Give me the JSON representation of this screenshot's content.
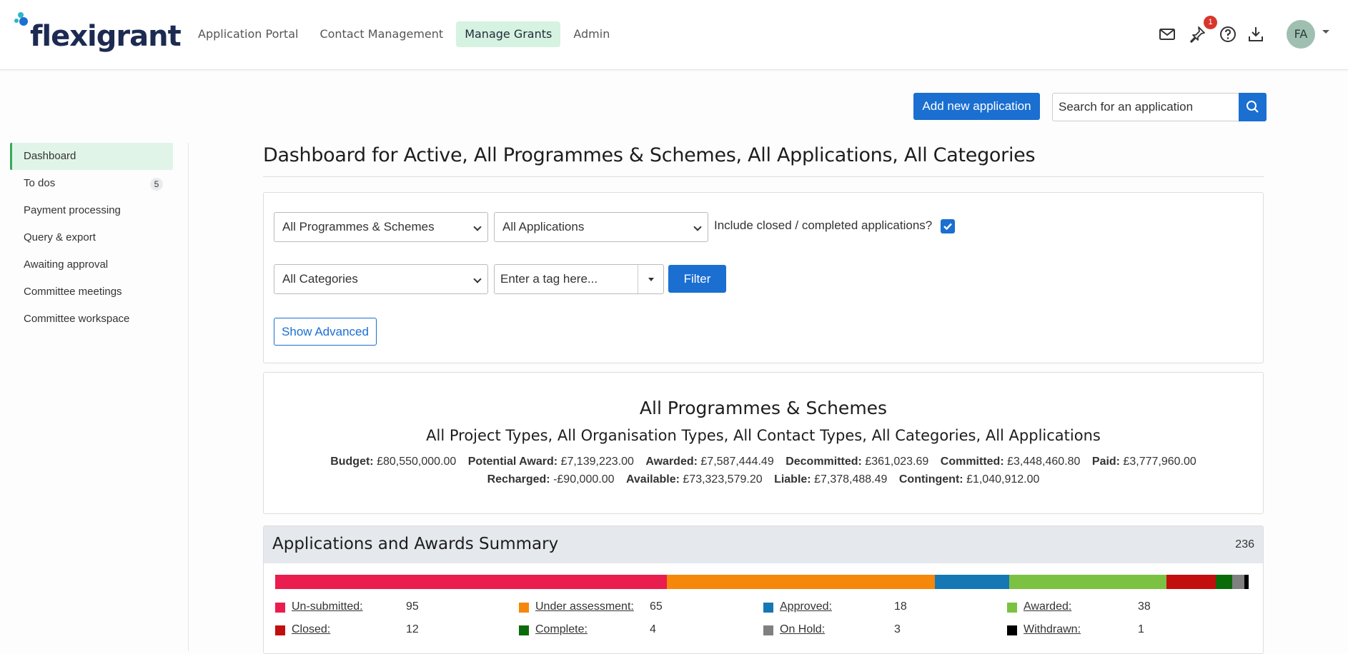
{
  "brand": {
    "logo_text": "flexigrant"
  },
  "nav": [
    {
      "label": "Application Portal"
    },
    {
      "label": "Contact Management"
    },
    {
      "label": "Manage Grants",
      "active": true
    },
    {
      "label": "Admin"
    }
  ],
  "header": {
    "icons": [
      "mail-icon",
      "pin-icon",
      "help-icon",
      "download-icon"
    ],
    "notification_count": "1",
    "avatar_initials": "FA"
  },
  "actions": {
    "add_label": "Add new application",
    "search_placeholder": "Search for an application"
  },
  "sidebar": {
    "items": [
      {
        "label": "Dashboard",
        "active": true
      },
      {
        "label": "To dos",
        "count": "5"
      },
      {
        "label": "Payment processing"
      },
      {
        "label": "Query & export"
      },
      {
        "label": "Awaiting approval"
      },
      {
        "label": "Committee meetings"
      },
      {
        "label": "Committee workspace"
      }
    ]
  },
  "page": {
    "title": "Dashboard for Active, All Programmes & Schemes, All Applications, All Categories"
  },
  "filters": {
    "programme": "All Programmes & Schemes",
    "applications": "All Applications",
    "include_label": "Include closed / completed applications?",
    "include_checked": true,
    "category": "All Categories",
    "tag_placeholder": "Enter a tag here...",
    "filter_label": "Filter",
    "advanced_label": "Show Advanced"
  },
  "summary": {
    "heading": "All Programmes & Schemes",
    "subheading": "All Project Types, All Organisation Types, All Contact Types, All Categories, All Applications",
    "row1": [
      {
        "label": "Budget:",
        "value": "£80,550,000.00"
      },
      {
        "label": "Potential Award:",
        "value": "£7,139,223.00"
      },
      {
        "label": "Awarded:",
        "value": "£7,587,444.49"
      },
      {
        "label": "Decommitted:",
        "value": "£361,023.69"
      },
      {
        "label": "Committed:",
        "value": "£3,448,460.80"
      },
      {
        "label": "Paid:",
        "value": "£3,777,960.00"
      }
    ],
    "row2": [
      {
        "label": "Recharged:",
        "value": "-£90,000.00"
      },
      {
        "label": "Available:",
        "value": "£73,323,579.20"
      },
      {
        "label": "Liable:",
        "value": "£7,378,488.49"
      },
      {
        "label": "Contingent:",
        "value": "£1,040,912.00"
      }
    ]
  },
  "apps_summary": {
    "title": "Applications and Awards Summary",
    "total": "236",
    "statuses": [
      {
        "label": "Un-submitted:",
        "value": 95,
        "color": "#e91e4e"
      },
      {
        "label": "Under assessment:",
        "value": 65,
        "color": "#f5870a"
      },
      {
        "label": "Approved:",
        "value": 18,
        "color": "#1578b5"
      },
      {
        "label": "Awarded:",
        "value": 38,
        "color": "#7cc242"
      },
      {
        "label": "Closed:",
        "value": 12,
        "color": "#c30e0e"
      },
      {
        "label": "Complete:",
        "value": 4,
        "color": "#0b6b0b"
      },
      {
        "label": "On Hold:",
        "value": 3,
        "color": "#808080"
      },
      {
        "label": "Withdrawn:",
        "value": 1,
        "color": "#000000"
      }
    ]
  }
}
